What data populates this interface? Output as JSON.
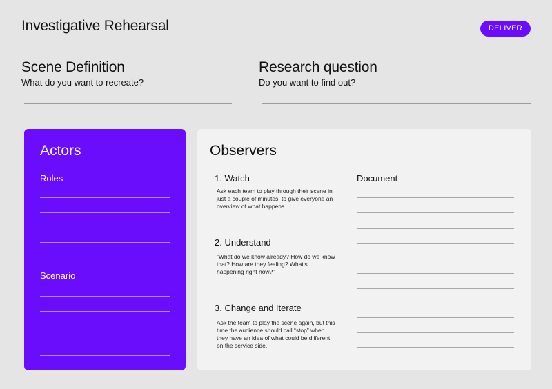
{
  "header": {
    "title": "Investigative Rehearsal",
    "deliver_label": "DELIVER"
  },
  "scene": {
    "title": "Scene Definition",
    "subtitle": "What do you want to recreate?"
  },
  "research": {
    "title": "Research question",
    "subtitle": "Do you want to find out?"
  },
  "actors": {
    "title": "Actors",
    "roles_label": "Roles",
    "scenario_label": "Scenario"
  },
  "observers": {
    "title": "Observers",
    "document_label": "Document",
    "steps": [
      {
        "title": "1. Watch",
        "description": "Ask each team to play through their scene in just a couple of minutes, to give everyone an overview of what happens"
      },
      {
        "title": "2. Understand",
        "description": "“What do we know already? How do we know that? How are they feeling? What’s happening right now?”"
      },
      {
        "title": "3. Change and Iterate",
        "description": "Ask the team to play the scene again, but this time the audience should call “stop” when they have an idea of what could be different on the service side."
      }
    ]
  },
  "colors": {
    "accent": "#6a0dfd",
    "background": "#e5e5e6",
    "panel": "#f2f2f2"
  }
}
